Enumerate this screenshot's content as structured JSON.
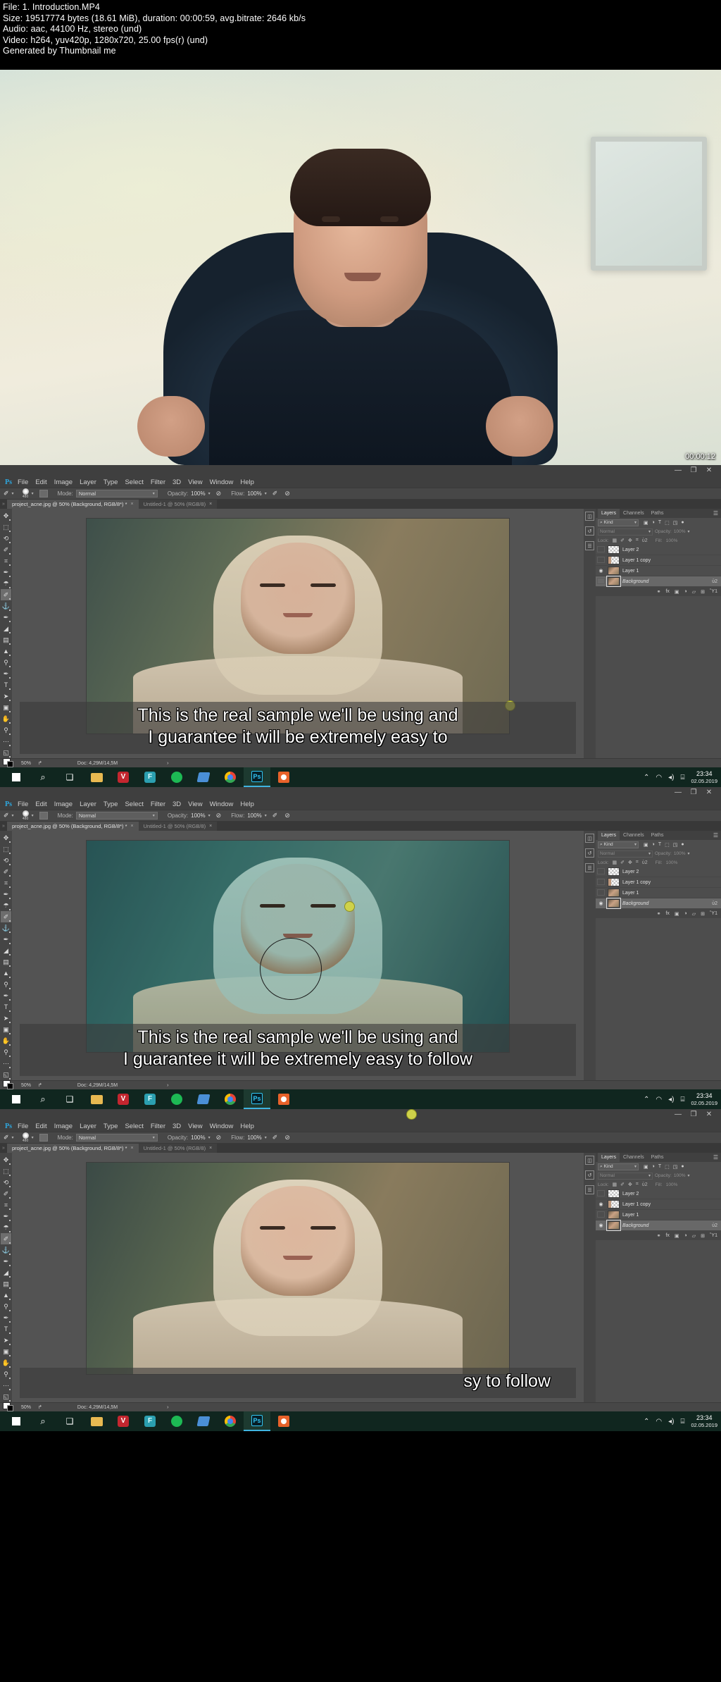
{
  "file_info": {
    "line1": "File: 1. Introduction.MP4",
    "line2": "Size: 19517774 bytes (18.61 MiB), duration: 00:00:59, avg.bitrate: 2646 kb/s",
    "line3": "Audio: aac, 44100 Hz, stereo (und)",
    "line4": "Video: h264, yuv420p, 1280x720, 25.00 fps(r) (und)",
    "line5": "Generated by Thumbnail me"
  },
  "hero": {
    "timestamp": "00:00:12"
  },
  "photoshop": {
    "app_logo": "Ps",
    "window_controls": {
      "minimize": "—",
      "restore": "❐",
      "close": "✕"
    },
    "menus": [
      "File",
      "Edit",
      "Image",
      "Layer",
      "Type",
      "Select",
      "Filter",
      "3D",
      "View",
      "Window",
      "Help"
    ],
    "options_bar": {
      "brush_size": "480",
      "mode_label": "Mode:",
      "mode_value": "Normal",
      "opacity_label": "Opacity:",
      "opacity_value": "100%",
      "flow_label": "Flow:",
      "flow_value": "100%"
    },
    "tabs": [
      {
        "label": "project_acne.jpg @ 50% (Background, RGB/8*) *",
        "close": "×",
        "active": true
      },
      {
        "label": "Untitled-1 @ 50% (RGB/8)",
        "close": "×",
        "active": false
      }
    ],
    "tools": [
      {
        "name": "move-tool",
        "glyph": "✥"
      },
      {
        "name": "marquee-tool",
        "glyph": "⬚"
      },
      {
        "name": "lasso-tool",
        "glyph": "⟲"
      },
      {
        "name": "quick-selection-tool",
        "glyph": "✐"
      },
      {
        "name": "crop-tool",
        "glyph": "⌗"
      },
      {
        "name": "eyedropper-tool",
        "glyph": "✒"
      },
      {
        "name": "spot-healing-tool",
        "glyph": "☂"
      },
      {
        "name": "brush-tool",
        "glyph": "✐"
      },
      {
        "name": "clone-stamp-tool",
        "glyph": "⚓"
      },
      {
        "name": "history-brush-tool",
        "glyph": "✒"
      },
      {
        "name": "eraser-tool",
        "glyph": "◢"
      },
      {
        "name": "gradient-tool",
        "glyph": "▤"
      },
      {
        "name": "blur-tool",
        "glyph": "▲"
      },
      {
        "name": "dodge-tool",
        "glyph": "⚲"
      },
      {
        "name": "pen-tool",
        "glyph": "✒"
      },
      {
        "name": "type-tool",
        "glyph": "T"
      },
      {
        "name": "path-selection-tool",
        "glyph": "➤"
      },
      {
        "name": "rectangle-tool",
        "glyph": "▣"
      },
      {
        "name": "hand-tool",
        "glyph": "✋"
      },
      {
        "name": "zoom-tool",
        "glyph": "⚲"
      },
      {
        "name": "more-tools",
        "glyph": "⋯"
      }
    ],
    "panel": {
      "tabs": [
        "Layers",
        "Channels",
        "Paths"
      ],
      "menu_glyph": "☰",
      "kind_label": "Kind",
      "search_glyph": "⌕",
      "filter_icons": [
        "image-filter-icon",
        "adjustment-filter-icon",
        "type-filter-icon",
        "shape-filter-icon",
        "smart-object-filter-icon",
        "toggle-filter-icon"
      ],
      "blend_mode": "Normal",
      "opacity_label": "Opacity:",
      "opacity_value": "100%",
      "lock_label": "Lock:",
      "lock_icons": [
        "lock-transparent-icon",
        "lock-image-icon",
        "lock-position-icon",
        "lock-artboard-icon",
        "lock-all-icon"
      ],
      "fill_label": "Fill:",
      "fill_value": "100%",
      "footer_icons": [
        "link-icon",
        "fx-icon",
        "mask-icon",
        "adjustment-icon",
        "group-icon",
        "new-layer-icon",
        "delete-icon"
      ]
    },
    "status_bar": {
      "zoom": "50%",
      "doc_label": "Doc: 4,29M/14,5M",
      "arrow": "›"
    }
  },
  "screens": [
    {
      "id": "screen-1",
      "layers": [
        {
          "name": "Layer 2",
          "visible": false,
          "thumb": "checker",
          "selected": false,
          "locked": false,
          "italic": false
        },
        {
          "name": "Layer 1 copy",
          "visible": false,
          "thumb": "partial",
          "selected": false,
          "locked": false,
          "italic": false
        },
        {
          "name": "Layer 1",
          "visible": true,
          "thumb": "photo",
          "selected": false,
          "locked": false,
          "italic": false
        },
        {
          "name": "Background",
          "visible": false,
          "thumb": "photo",
          "selected": true,
          "locked": true,
          "italic": true
        }
      ],
      "subtitle_lines": [
        "This is the real sample we'll be using and",
        "I guarantee it will be extremely easy to"
      ],
      "subtitle_align": "center"
    },
    {
      "id": "screen-2",
      "layers": [
        {
          "name": "Layer 2",
          "visible": false,
          "thumb": "checker",
          "selected": false,
          "locked": false,
          "italic": false
        },
        {
          "name": "Layer 1 copy",
          "visible": false,
          "thumb": "partial",
          "selected": false,
          "locked": false,
          "italic": false
        },
        {
          "name": "Layer 1",
          "visible": false,
          "thumb": "photo",
          "selected": false,
          "locked": false,
          "italic": false
        },
        {
          "name": "Background",
          "visible": true,
          "thumb": "photo",
          "selected": true,
          "locked": true,
          "italic": true
        }
      ],
      "subtitle_lines": [
        "This is the real sample we'll be using and",
        "I guarantee it will be extremely easy to follow"
      ],
      "subtitle_align": "center"
    },
    {
      "id": "screen-3",
      "layers": [
        {
          "name": "Layer 2",
          "visible": false,
          "thumb": "checker",
          "selected": false,
          "locked": false,
          "italic": false
        },
        {
          "name": "Layer 1 copy",
          "visible": true,
          "thumb": "partial",
          "selected": false,
          "locked": false,
          "italic": false
        },
        {
          "name": "Layer 1",
          "visible": false,
          "thumb": "photo",
          "selected": false,
          "locked": false,
          "italic": false
        },
        {
          "name": "Background",
          "visible": true,
          "thumb": "photo",
          "selected": true,
          "locked": true,
          "italic": true
        }
      ],
      "subtitle_lines": [
        "sy to follow"
      ],
      "subtitle_align": "right"
    }
  ],
  "taskbar": {
    "icons": [
      "start-icon",
      "search-icon",
      "task-view-icon",
      "file-explorer-icon",
      "vivaldi-icon",
      "f-app-icon",
      "spotify-icon",
      "blue-app-icon",
      "chrome-icon",
      "photoshop-icon",
      "orange-app-icon"
    ],
    "tray": {
      "chevron": "⌃",
      "wifi": "◠",
      "volume": "◂)",
      "notifications": "⌸"
    },
    "clock_time": "23:34",
    "clock_date": "02.05.2019"
  },
  "colors": {
    "ps_chrome": "#535353",
    "ps_dark": "#3f3f3f",
    "accent_blue": "#2ea8e0",
    "taskbar": "#10261f",
    "cursor_yellow": "#cfd24a"
  }
}
